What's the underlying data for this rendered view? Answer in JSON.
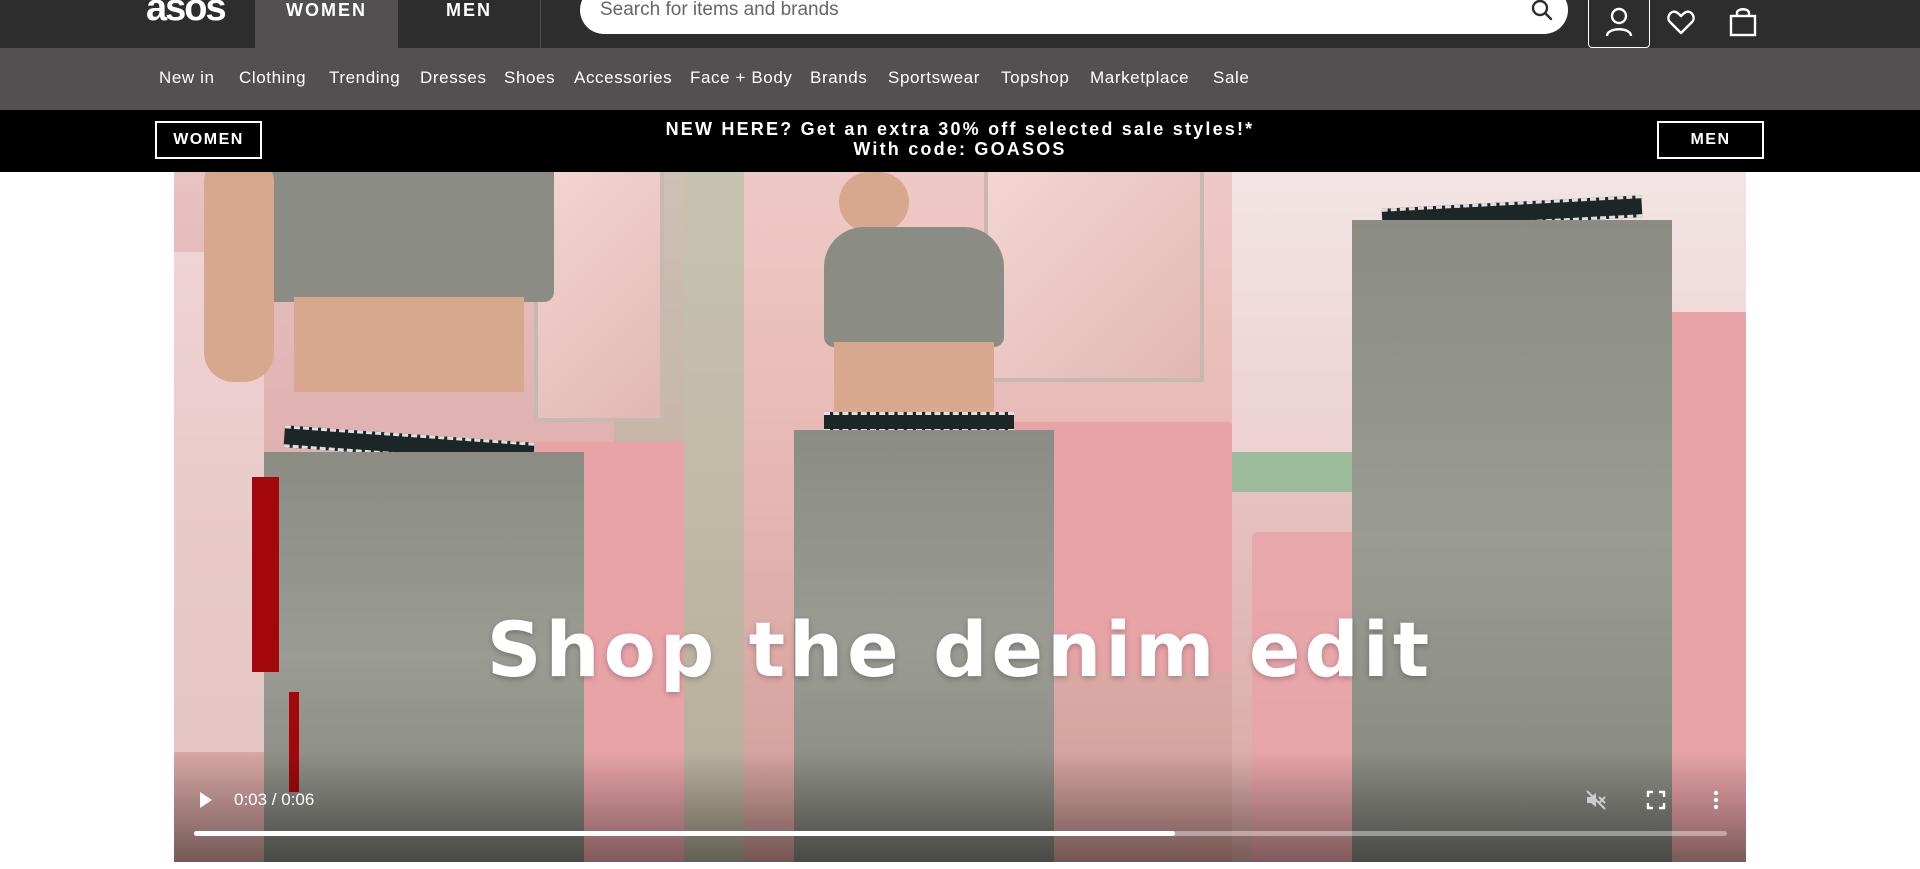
{
  "header": {
    "logo": "asos",
    "tabs": [
      {
        "label": "WOMEN",
        "active": true
      },
      {
        "label": "MEN",
        "active": false
      }
    ],
    "search": {
      "placeholder": "Search for items and brands",
      "value": ""
    },
    "icons": [
      "search-icon",
      "account-icon",
      "heart-icon",
      "bag-icon"
    ]
  },
  "nav": {
    "items": [
      "New in",
      "Clothing",
      "Trending",
      "Dresses",
      "Shoes",
      "Accessories",
      "Face + Body",
      "Brands",
      "Sportswear",
      "Topshop",
      "Marketplace",
      "Sale"
    ]
  },
  "promo": {
    "women_button": "WOMEN",
    "men_button": "MEN",
    "line1": "NEW HERE? Get an extra 30% off selected sale styles!*",
    "line2": "With code: GOASOS"
  },
  "hero": {
    "title": "Shop the denim edit",
    "video": {
      "time": "0:03 / 0:06",
      "progress": 0.64,
      "icons": [
        "play-icon",
        "mute-icon",
        "fullscreen-icon",
        "more-vert-icon"
      ]
    }
  },
  "colors": {
    "topbar": "#2d2d2d",
    "navbar": "#525050",
    "promo_bg": "#000000",
    "text_light": "#ffffff"
  }
}
